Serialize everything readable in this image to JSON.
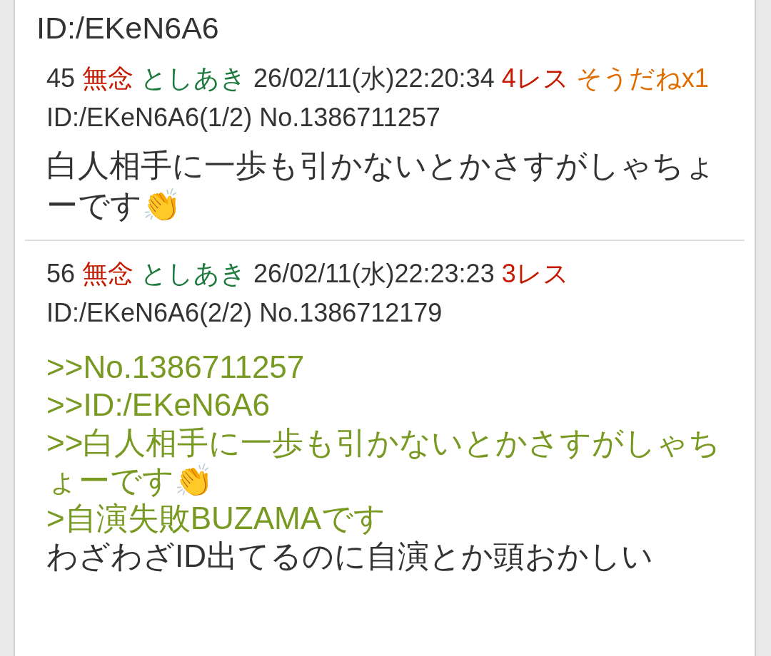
{
  "header_id": "ID:/EKeN6A6",
  "posts": [
    {
      "number": "45",
      "name": "無念",
      "handle": "としあき",
      "date": "26/02/11(水)22:20:34",
      "replies": "4レス",
      "sodane": "そうだねx1",
      "id": "ID:/EKeN6A6(1/2)",
      "no": "No.1386711257",
      "lines": [
        {
          "kind": "plain",
          "text": "白人相手に一歩も引かないとかさすがしゃちょーです👏"
        }
      ]
    },
    {
      "number": "56",
      "name": "無念",
      "handle": "としあき",
      "date": "26/02/11(水)22:23:23",
      "replies": "3レス",
      "id": "ID:/EKeN6A6(2/2)",
      "no": "No.1386712179",
      "lines": [
        {
          "kind": "quote",
          "text": ">>No.1386711257"
        },
        {
          "kind": "quote",
          "text": ">>ID:/EKeN6A6"
        },
        {
          "kind": "quote",
          "text": ">>白人相手に一歩も引かないとかさすがしゃちょーです👏"
        },
        {
          "kind": "quote",
          "text": ">自演失敗BUZAMAです"
        },
        {
          "kind": "plain",
          "text": "わざわざID出てるのに自演とか頭おかしい"
        }
      ]
    }
  ]
}
